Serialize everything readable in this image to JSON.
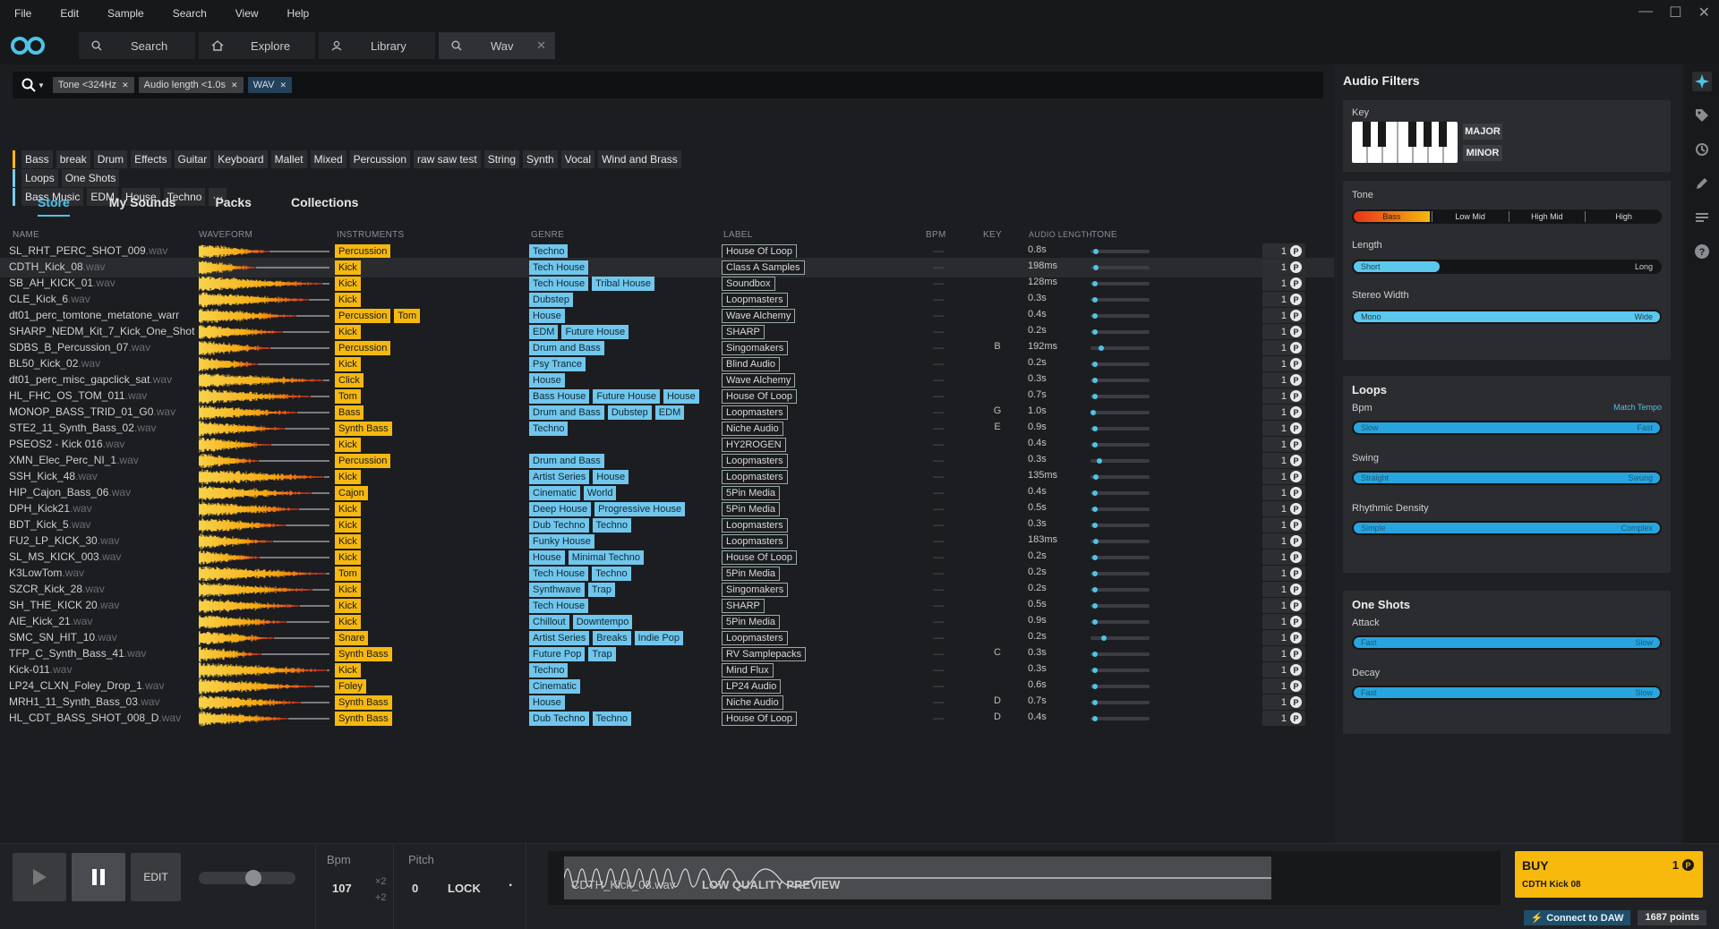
{
  "menu": [
    "File",
    "Edit",
    "Sample",
    "Search",
    "View",
    "Help"
  ],
  "tabs": [
    {
      "label": "Search",
      "icon": "search-icon"
    },
    {
      "label": "Explore",
      "icon": "home-icon"
    },
    {
      "label": "Library",
      "icon": "user-icon"
    },
    {
      "label": "Wav",
      "icon": "search-icon"
    }
  ],
  "filters": [
    "Tone <324Hz",
    "Audio length <1.0s",
    "WAV"
  ],
  "tag_rows": [
    {
      "color": "#f5b80f",
      "tags": [
        "Bass",
        "break",
        "Drum",
        "Effects",
        "Guitar",
        "Keyboard",
        "Mallet",
        "Mixed",
        "Percussion",
        "raw saw test",
        "String",
        "Synth",
        "Vocal",
        "Wind and Brass"
      ]
    },
    {
      "color": "#7ec8e8",
      "tags": [
        "Loops",
        "One Shots"
      ]
    },
    {
      "color": "#7ec8e8",
      "tags": [
        "Bass Music",
        "EDM",
        "House",
        "Techno",
        "···"
      ]
    }
  ],
  "subtabs": [
    "Store",
    "My Sounds",
    "Packs",
    "Collections"
  ],
  "columns": {
    "name": "NAME",
    "waveform": "WAVEFORM",
    "instruments": "INSTRUMENTS",
    "genre": "GENRE",
    "label": "LABEL",
    "bpm": "BPM",
    "key": "KEY",
    "audio_length": "AUDIO LENGTH",
    "tone": "TONE"
  },
  "rows": [
    {
      "name": "SL_RHT_PERC_SHOT_009",
      "ext": ".wav",
      "instruments": [
        "Percussion"
      ],
      "genres": [
        "Techno"
      ],
      "label": "House Of Loop",
      "key": "",
      "length": "0.8s",
      "tone": 0.05,
      "count": "1"
    },
    {
      "name": "CDTH_Kick_08",
      "ext": ".wav",
      "instruments": [
        "Kick"
      ],
      "genres": [
        "Tech House"
      ],
      "label": "Class A Samples",
      "key": "",
      "length": "198ms",
      "tone": 0.05,
      "count": "1"
    },
    {
      "name": "SB_AH_KICK_01",
      "ext": ".wav",
      "instruments": [
        "Kick"
      ],
      "genres": [
        "Tech House",
        "Tribal House"
      ],
      "label": "Soundbox",
      "key": "",
      "length": "128ms",
      "tone": 0.03,
      "count": "1"
    },
    {
      "name": "CLE_Kick_6",
      "ext": ".wav",
      "instruments": [
        "Kick"
      ],
      "genres": [
        "Dubstep"
      ],
      "label": "Loopmasters",
      "key": "",
      "length": "0.3s",
      "tone": 0.03,
      "count": "1"
    },
    {
      "name": "dt01_perc_tomtone_metatone_warr",
      "ext": "",
      "instruments": [
        "Percussion",
        "Tom"
      ],
      "genres": [
        "House"
      ],
      "label": "Wave Alchemy",
      "key": "",
      "length": "0.4s",
      "tone": 0.03,
      "count": "1"
    },
    {
      "name": "SHARP_NEDM_Kit_7_Kick_One_Shot",
      "ext": "",
      "instruments": [
        "Kick"
      ],
      "genres": [
        "EDM",
        "Future House"
      ],
      "label": "SHARP",
      "key": "",
      "length": "0.2s",
      "tone": 0.03,
      "count": "1"
    },
    {
      "name": "SDBS_B_Percussion_07",
      "ext": ".wav",
      "instruments": [
        "Percussion"
      ],
      "genres": [
        "Drum and Bass"
      ],
      "label": "Singomakers",
      "key": "B",
      "length": "192ms",
      "tone": 0.15,
      "count": "1"
    },
    {
      "name": "BL50_Kick_02",
      "ext": ".wav",
      "instruments": [
        "Kick"
      ],
      "genres": [
        "Psy Trance"
      ],
      "label": "Blind Audio",
      "key": "",
      "length": "0.2s",
      "tone": 0.03,
      "count": "1"
    },
    {
      "name": "dt01_perc_misc_gapclick_sat",
      "ext": ".wav",
      "instruments": [
        "Click"
      ],
      "genres": [
        "House"
      ],
      "label": "Wave Alchemy",
      "key": "",
      "length": "0.3s",
      "tone": 0.03,
      "count": "1"
    },
    {
      "name": "HL_FHC_OS_TOM_011",
      "ext": ".wav",
      "instruments": [
        "Tom"
      ],
      "genres": [
        "Bass House",
        "Future House",
        "House"
      ],
      "label": "House Of Loop",
      "key": "",
      "length": "0.7s",
      "tone": 0.03,
      "count": "1"
    },
    {
      "name": "MONOP_BASS_TRID_01_G0",
      "ext": ".wav",
      "instruments": [
        "Bass"
      ],
      "genres": [
        "Drum and Bass",
        "Dubstep",
        "EDM"
      ],
      "label": "Loopmasters",
      "key": "G",
      "length": "1.0s",
      "tone": 0.0,
      "count": "1"
    },
    {
      "name": "STE2_11_Synth_Bass_02",
      "ext": ".wav",
      "instruments": [
        "Synth Bass"
      ],
      "genres": [
        "Techno"
      ],
      "label": "Niche Audio",
      "key": "E",
      "length": "0.9s",
      "tone": 0.03,
      "count": "1"
    },
    {
      "name": "PSEOS2 - Kick 016",
      "ext": ".wav",
      "instruments": [
        "Kick"
      ],
      "genres": [],
      "label": "HY2ROGEN",
      "key": "",
      "length": "0.4s",
      "tone": 0.03,
      "count": "1"
    },
    {
      "name": "XMN_Elec_Perc_NI_1",
      "ext": ".wav",
      "instruments": [
        "Percussion"
      ],
      "genres": [
        "Drum and Bass"
      ],
      "label": "Loopmasters",
      "key": "",
      "length": "0.3s",
      "tone": 0.12,
      "count": "1"
    },
    {
      "name": "SSH_Kick_48",
      "ext": ".wav",
      "instruments": [
        "Kick"
      ],
      "genres": [
        "Artist Series",
        "House"
      ],
      "label": "Loopmasters",
      "key": "",
      "length": "135ms",
      "tone": 0.05,
      "count": "1"
    },
    {
      "name": "HIP_Cajon_Bass_06",
      "ext": ".wav",
      "instruments": [
        "Cajon"
      ],
      "genres": [
        "Cinematic",
        "World"
      ],
      "label": "5Pin Media",
      "key": "",
      "length": "0.4s",
      "tone": 0.03,
      "count": "1"
    },
    {
      "name": "DPH_Kick21",
      "ext": ".wav",
      "instruments": [
        "Kick"
      ],
      "genres": [
        "Deep House",
        "Progressive House"
      ],
      "label": "5Pin Media",
      "key": "",
      "length": "0.5s",
      "tone": 0.03,
      "count": "1"
    },
    {
      "name": "BDT_Kick_5",
      "ext": ".wav",
      "instruments": [
        "Kick"
      ],
      "genres": [
        "Dub Techno",
        "Techno"
      ],
      "label": "Loopmasters",
      "key": "",
      "length": "0.3s",
      "tone": 0.03,
      "count": "1"
    },
    {
      "name": "FU2_LP_KICK_30",
      "ext": ".wav",
      "instruments": [
        "Kick"
      ],
      "genres": [
        "Funky House"
      ],
      "label": "Loopmasters",
      "key": "",
      "length": "183ms",
      "tone": 0.05,
      "count": "1"
    },
    {
      "name": "SL_MS_KICK_003",
      "ext": ".wav",
      "instruments": [
        "Kick"
      ],
      "genres": [
        "House",
        "Minimal Techno"
      ],
      "label": "House Of Loop",
      "key": "",
      "length": "0.2s",
      "tone": 0.03,
      "count": "1"
    },
    {
      "name": "K3LowTom",
      "ext": ".wav",
      "instruments": [
        "Tom"
      ],
      "genres": [
        "Tech House",
        "Techno"
      ],
      "label": "5Pin Media",
      "key": "",
      "length": "0.2s",
      "tone": 0.03,
      "count": "1"
    },
    {
      "name": "SZCR_Kick_28",
      "ext": ".wav",
      "instruments": [
        "Kick"
      ],
      "genres": [
        "Synthwave",
        "Trap"
      ],
      "label": "Singomakers",
      "key": "",
      "length": "0.2s",
      "tone": 0.03,
      "count": "1"
    },
    {
      "name": "SH_THE_KICK 20",
      "ext": ".wav",
      "instruments": [
        "Kick"
      ],
      "genres": [
        "Tech House"
      ],
      "label": "SHARP",
      "key": "",
      "length": "0.5s",
      "tone": 0.03,
      "count": "1"
    },
    {
      "name": "AIE_Kick_21",
      "ext": ".wav",
      "instruments": [
        "Kick"
      ],
      "genres": [
        "Chillout",
        "Downtempo"
      ],
      "label": "5Pin Media",
      "key": "",
      "length": "0.9s",
      "tone": 0.03,
      "count": "1"
    },
    {
      "name": "SMC_SN_HIT_10",
      "ext": ".wav",
      "instruments": [
        "Snare"
      ],
      "genres": [
        "Artist Series",
        "Breaks",
        "Indie Pop"
      ],
      "label": "Loopmasters",
      "key": "",
      "length": "0.2s",
      "tone": 0.2,
      "count": "1"
    },
    {
      "name": "TFP_C_Synth_Bass_41",
      "ext": ".wav",
      "instruments": [
        "Synth Bass"
      ],
      "genres": [
        "Future Pop",
        "Trap"
      ],
      "label": "RV Samplepacks",
      "key": "C",
      "length": "0.3s",
      "tone": 0.03,
      "count": "1"
    },
    {
      "name": "Kick-011",
      "ext": ".wav",
      "instruments": [
        "Kick"
      ],
      "genres": [
        "Techno"
      ],
      "label": "Mind Flux",
      "key": "",
      "length": "0.3s",
      "tone": 0.03,
      "count": "1"
    },
    {
      "name": "LP24_CLXN_Foley_Drop_1",
      "ext": ".wav",
      "instruments": [
        "Foley"
      ],
      "genres": [
        "Cinematic"
      ],
      "label": "LP24 Audio",
      "key": "",
      "length": "0.6s",
      "tone": 0.03,
      "count": "1"
    },
    {
      "name": "MRH1_11_Synth_Bass_03",
      "ext": ".wav",
      "instruments": [
        "Synth Bass"
      ],
      "genres": [
        "House"
      ],
      "label": "Niche Audio",
      "key": "D",
      "length": "0.7s",
      "tone": 0.03,
      "count": "1"
    },
    {
      "name": "HL_CDT_BASS_SHOT_008_D",
      "ext": ".wav",
      "instruments": [
        "Synth Bass"
      ],
      "genres": [
        "Dub Techno",
        "Techno"
      ],
      "label": "House Of Loop",
      "key": "D",
      "length": "0.4s",
      "tone": 0.03,
      "count": "1"
    }
  ],
  "panel": {
    "title": "Audio Filters",
    "key_label": "Key",
    "major": "MAJOR",
    "minor": "MINOR",
    "tone_label": "Tone",
    "tone_bands": [
      "Bass",
      "Low Mid",
      "High Mid",
      "High"
    ],
    "length_label": "Length",
    "length_left": "Short",
    "length_right": "Long",
    "stereo_label": "Stereo Width",
    "stereo_left": "Mono",
    "stereo_right": "Wide",
    "loops_title": "Loops",
    "bpm_label": "Bpm",
    "match_tempo": "Match Tempo",
    "bpm_left": "Slow",
    "bpm_right": "Fast",
    "swing_label": "Swing",
    "swing_left": "Straight",
    "swing_right": "Swung",
    "density_label": "Rhythmic Density",
    "density_left": "Simple",
    "density_right": "Complex",
    "oneshots_title": "One Shots",
    "attack_label": "Attack",
    "attack_left": "Fast",
    "attack_right": "Slow",
    "decay_label": "Decay",
    "decay_left": "Fast",
    "decay_right": "Slow"
  },
  "player": {
    "edit": "EDIT",
    "bpm_label": "Bpm",
    "pitch_label": "Pitch",
    "bpm_value": "107",
    "x2": "×2",
    "plus2": "+2",
    "pitch_value": "0",
    "lock": "LOCK",
    "dot": "·",
    "preview_name": "CDTH_Kick_08.wav",
    "preview_note": "LOW QUALITY PREVIEW",
    "buy": "BUY",
    "buy_price": "1",
    "buy_sample": "CDTH Kick 08",
    "connect": "Connect to DAW",
    "points": "1687 points",
    "volume": 0.58
  },
  "colors": {
    "accent": "#4fc3e8",
    "instrument": "#f5b80f",
    "genre": "#71c6ec"
  }
}
